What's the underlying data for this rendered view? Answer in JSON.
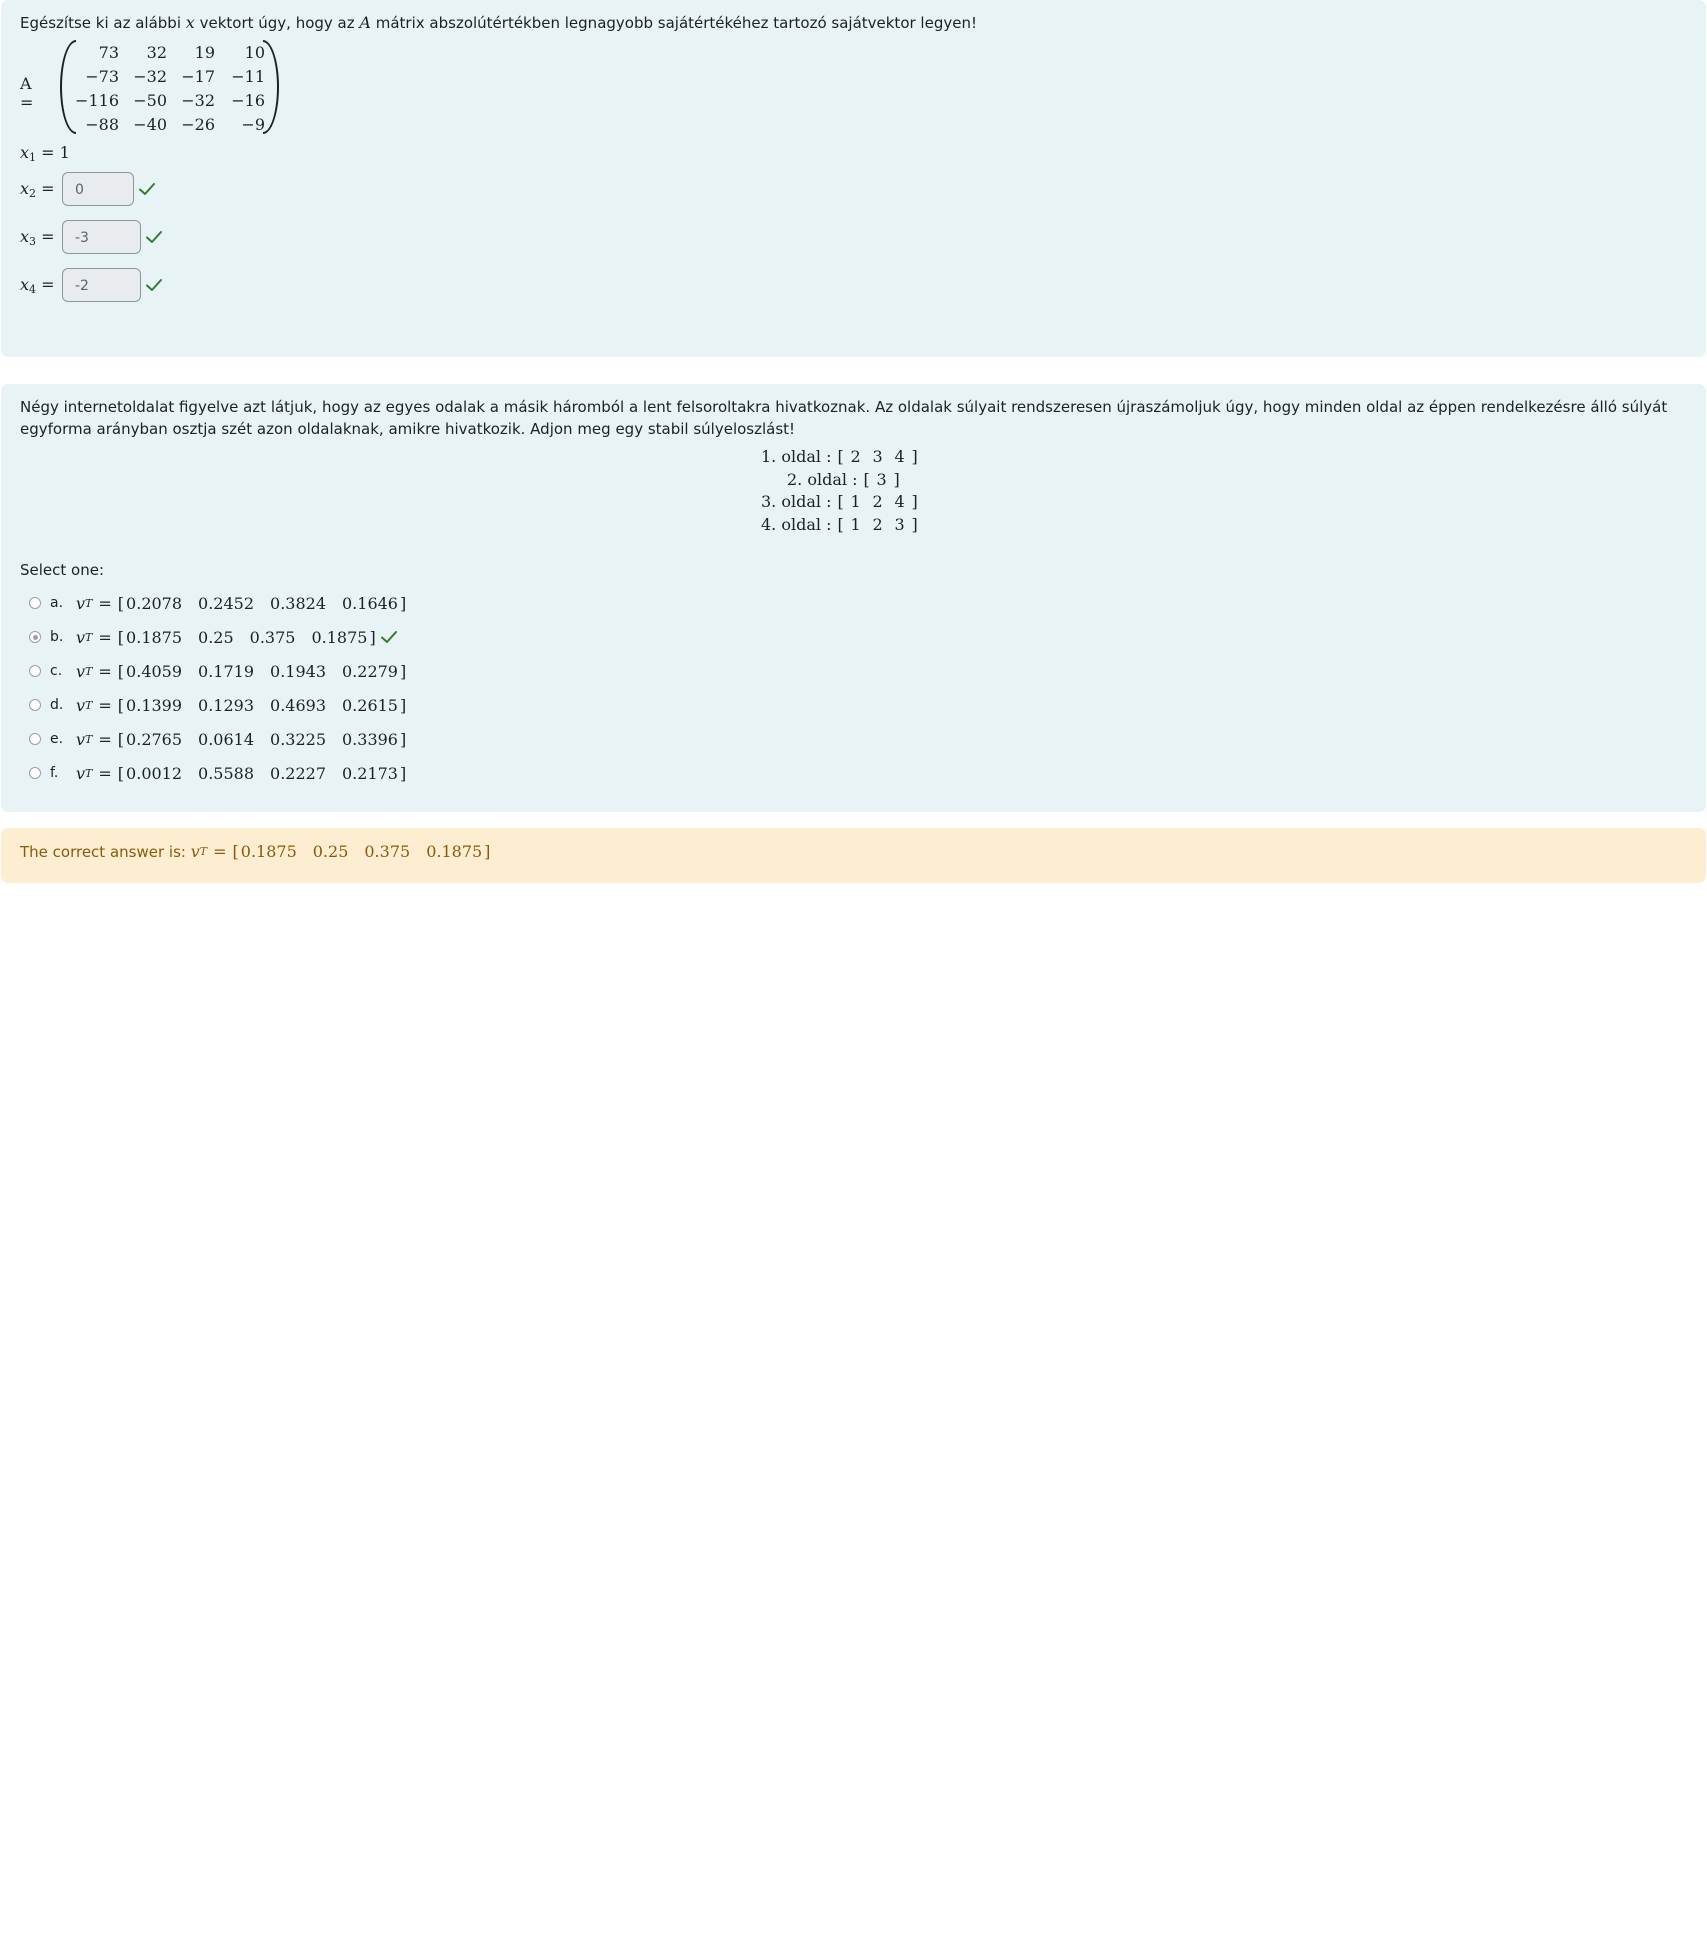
{
  "q1": {
    "prompt_before_x": "Egészítse ki az alábbi",
    "x_symbol": "x",
    "prompt_middle": "vektort úgy, hogy az",
    "A_symbol": "A",
    "prompt_after": "mátrix abszolútértékben legnagyobb sajátértékéhez tartozó sajátvektor legyen!",
    "matrix_label": "A =",
    "matrix": [
      [
        "73",
        "32",
        "19",
        "10"
      ],
      [
        "−73",
        "−32",
        "−17",
        "−11"
      ],
      [
        "−116",
        "−50",
        "−32",
        "−16"
      ],
      [
        "−88",
        "−40",
        "−26",
        "−9"
      ]
    ],
    "x1_label": "x",
    "x1_sub": "1",
    "x1_value": "= 1",
    "answers": [
      {
        "label": "x",
        "sub": "2",
        "eq": "=",
        "value": "0",
        "correct": true
      },
      {
        "label": "x",
        "sub": "3",
        "eq": "=",
        "value": "-3",
        "correct": true
      },
      {
        "label": "x",
        "sub": "4",
        "eq": "=",
        "value": "-2",
        "correct": true
      }
    ]
  },
  "q2": {
    "prompt": "Négy internetoldalat figyelve azt látjuk, hogy az egyes odalak a másik háromból a lent felsoroltakra hivatkoznak. Az oldalak súlyait rendszeresen újraszámoljuk úgy, hogy minden oldal az éppen rendelkezésre álló súlyát egyforma arányban osztja szét azon oldalaknak, amikre hivatkozik. Adjon meg egy stabil súlyeloszlást!",
    "links": [
      {
        "label": "1. oldal :",
        "targets": [
          "2",
          "3",
          "4"
        ]
      },
      {
        "label": "2. oldal :",
        "targets": [
          "3"
        ]
      },
      {
        "label": "3. oldal :",
        "targets": [
          "1",
          "2",
          "4"
        ]
      },
      {
        "label": "4. oldal :",
        "targets": [
          "1",
          "2",
          "3"
        ]
      }
    ],
    "select_one": "Select one:",
    "vector_label": "v",
    "vector_sup": "T",
    "options": [
      {
        "letter": "a.",
        "values": [
          "0.2078",
          "0.2452",
          "0.3824",
          "0.1646"
        ],
        "selected": false,
        "correct": false
      },
      {
        "letter": "b.",
        "values": [
          "0.1875",
          "0.25",
          "0.375",
          "0.1875"
        ],
        "selected": true,
        "correct": true
      },
      {
        "letter": "c.",
        "values": [
          "0.4059",
          "0.1719",
          "0.1943",
          "0.2279"
        ],
        "selected": false,
        "correct": false
      },
      {
        "letter": "d.",
        "values": [
          "0.1399",
          "0.1293",
          "0.4693",
          "0.2615"
        ],
        "selected": false,
        "correct": false
      },
      {
        "letter": "e.",
        "values": [
          "0.2765",
          "0.0614",
          "0.3225",
          "0.3396"
        ],
        "selected": false,
        "correct": false
      },
      {
        "letter": "f.",
        "values": [
          "0.0012",
          "0.5588",
          "0.2227",
          "0.2173"
        ],
        "selected": false,
        "correct": false
      }
    ]
  },
  "feedback": {
    "prefix": "The correct answer is:",
    "values": [
      "0.1875",
      "0.25",
      "0.375",
      "0.1875"
    ]
  },
  "colors": {
    "panel": "#e7f3f5",
    "feedback_bg": "#fdedd1",
    "feedback_text": "#8a5a0b",
    "check": "#357a32"
  },
  "icons": {
    "check": "check-icon",
    "radio": "radio-button"
  }
}
